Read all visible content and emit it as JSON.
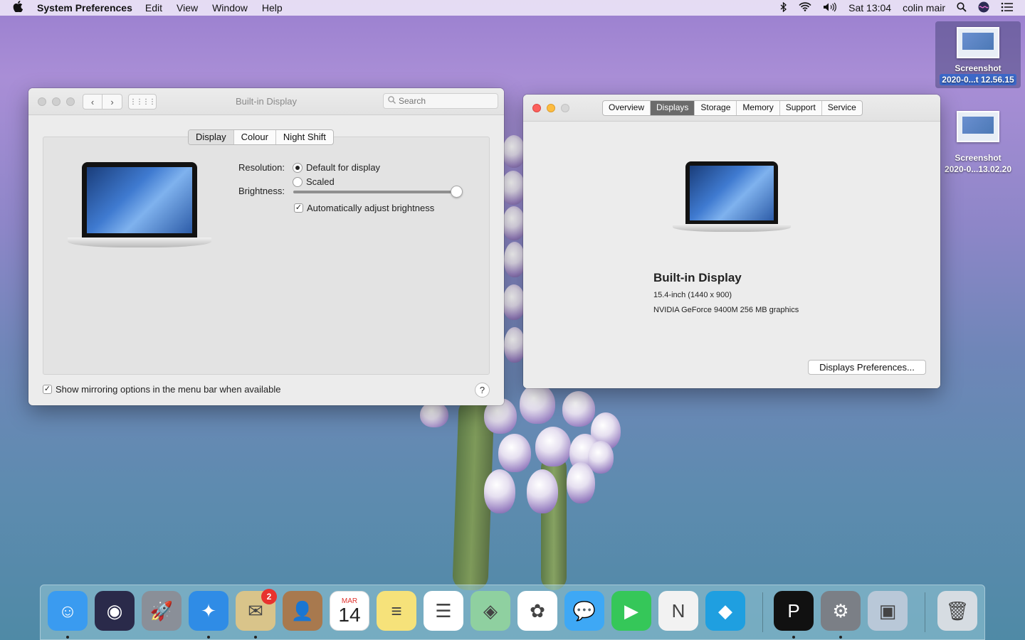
{
  "menubar": {
    "app_name": "System Preferences",
    "menus": [
      "Edit",
      "View",
      "Window",
      "Help"
    ],
    "clock": "Sat 13:04",
    "user": "colin mair"
  },
  "desktop": {
    "icons": [
      {
        "line1": "Screenshot",
        "line2": "2020-0...t 12.56.15"
      },
      {
        "line1": "Screenshot",
        "line2": "2020-0...13.02.20"
      }
    ]
  },
  "prefs_window": {
    "title": "Built-in Display",
    "search_placeholder": "Search",
    "tabs": [
      "Display",
      "Colour",
      "Night Shift"
    ],
    "active_tab": "Display",
    "resolution_label": "Resolution:",
    "resolution_options": [
      "Default for display",
      "Scaled"
    ],
    "resolution_selected": "Default for display",
    "brightness_label": "Brightness:",
    "brightness_level": 0.99,
    "auto_brightness_label": "Automatically adjust brightness",
    "auto_brightness_checked": true,
    "mirroring_label": "Show mirroring options in the menu bar when available",
    "mirroring_checked": true,
    "help_label": "?"
  },
  "about_window": {
    "tabs": [
      "Overview",
      "Displays",
      "Storage",
      "Memory",
      "Support",
      "Service"
    ],
    "active_tab": "Displays",
    "display_name": "Built-in Display",
    "display_size": "15.4-inch (1440 x 900)",
    "graphics": "NVIDIA GeForce 9400M 256 MB graphics",
    "prefs_button": "Displays Preferences..."
  },
  "dock": {
    "items": [
      {
        "name": "finder-icon",
        "color": "#3a9bf0",
        "running": true
      },
      {
        "name": "siri-icon",
        "color": "#2a2a4a",
        "running": false
      },
      {
        "name": "launchpad-icon",
        "color": "#8a8f98",
        "running": false
      },
      {
        "name": "safari-icon",
        "color": "#2f8ce6",
        "running": true
      },
      {
        "name": "mail-icon",
        "color": "#d9c48a",
        "running": true,
        "badge": "2"
      },
      {
        "name": "contacts-icon",
        "color": "#a8794e",
        "running": false
      },
      {
        "name": "calendar-icon",
        "color": "#ffffff",
        "running": false,
        "month": "MAR",
        "day": "14"
      },
      {
        "name": "notes-icon",
        "color": "#f6e27a",
        "running": false
      },
      {
        "name": "reminders-icon",
        "color": "#ffffff",
        "running": false
      },
      {
        "name": "maps-icon",
        "color": "#8fd0a0",
        "running": false
      },
      {
        "name": "photos-icon",
        "color": "#ffffff",
        "running": false
      },
      {
        "name": "messages-icon",
        "color": "#3ea8f5",
        "running": false
      },
      {
        "name": "facetime-icon",
        "color": "#35c759",
        "running": false
      },
      {
        "name": "news-icon",
        "color": "#f2f2f2",
        "running": false
      },
      {
        "name": "kodi-icon",
        "color": "#1f9fe0",
        "running": false
      },
      {
        "name": "plex-icon",
        "color": "#111111",
        "running": true
      },
      {
        "name": "system-preferences-icon",
        "color": "#7b7f86",
        "running": true
      },
      {
        "name": "preview-icon",
        "color": "#b9c8d8",
        "running": false
      },
      {
        "name": "trash-icon",
        "color": "#d6dce2",
        "running": false
      }
    ]
  }
}
